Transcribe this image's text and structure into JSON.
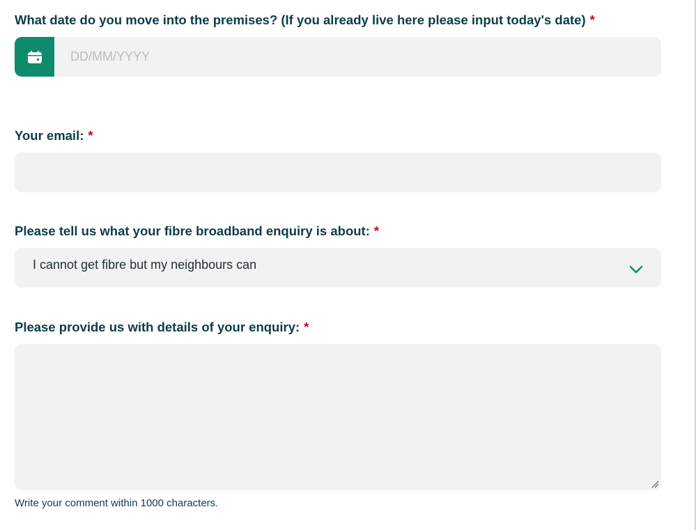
{
  "form": {
    "move_date": {
      "label": "What date do you move into the premises? (If you already live here please input today's date)",
      "required_mark": "*",
      "placeholder": "DD/MM/YYYY",
      "value": "",
      "icon": "calendar-icon"
    },
    "email": {
      "label": "Your email:",
      "required_mark": "*",
      "value": ""
    },
    "enquiry_type": {
      "label": "Please tell us what your fibre broadband enquiry is about:",
      "required_mark": "*",
      "selected": "I cannot get fibre but my neighbours can",
      "icon": "chevron-down-icon"
    },
    "details": {
      "label": "Please provide us with details of your enquiry:",
      "required_mark": "*",
      "value": "",
      "helper": "Write your comment within 1000 characters."
    }
  },
  "colors": {
    "accent": "#0e8a6d",
    "required": "#d0021b",
    "label_text": "#0f3b4a",
    "field_bg": "#f2f2f2",
    "placeholder": "#b9bcbf"
  }
}
